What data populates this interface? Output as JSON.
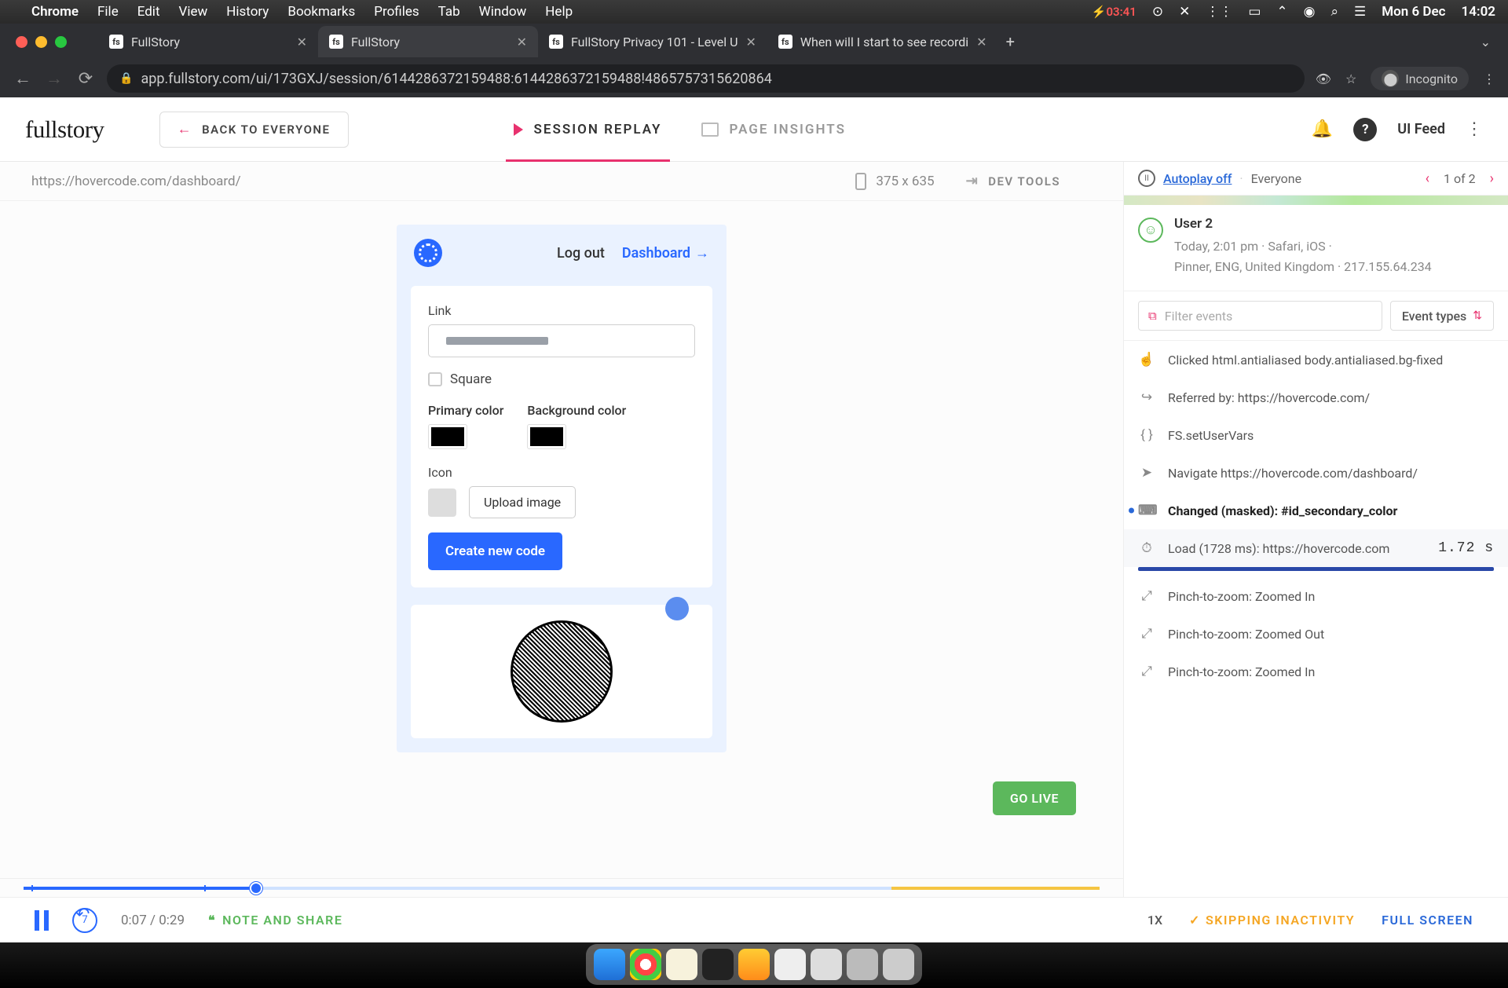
{
  "menubar": {
    "app": "Chrome",
    "items": [
      "File",
      "Edit",
      "View",
      "History",
      "Bookmarks",
      "Profiles",
      "Tab",
      "Window",
      "Help"
    ],
    "battery_time": "03:41",
    "date": "Mon 6 Dec",
    "clock": "14:02"
  },
  "browser": {
    "tabs": [
      {
        "title": "FullStory",
        "active": false
      },
      {
        "title": "FullStory",
        "active": true
      },
      {
        "title": "FullStory Privacy 101 - Level U",
        "active": false
      },
      {
        "title": "When will I start to see recordi",
        "active": false
      }
    ],
    "url": "app.fullstory.com/ui/173GXJ/session/6144286372159488:6144286372159488!4865757315620864",
    "incognito": "Incognito"
  },
  "header": {
    "logo": "fullstory",
    "back": "BACK TO EVERYONE",
    "tab_replay": "SESSION REPLAY",
    "tab_insights": "PAGE INSIGHTS",
    "ui_feed": "UI Feed"
  },
  "subbar": {
    "url": "https://hovercode.com/dashboard/",
    "dims": "375 x 635",
    "dev_tools": "DEV TOOLS"
  },
  "replay": {
    "logout": "Log out",
    "dashboard": "Dashboard",
    "link_label": "Link",
    "square_label": "Square",
    "primary_label": "Primary color",
    "background_label": "Background color",
    "icon_label": "Icon",
    "upload_label": "Upload image",
    "create_label": "Create new code",
    "go_live": "GO LIVE"
  },
  "event_pane": {
    "autoplay": "Autoplay off",
    "segment": "Everyone",
    "pager": "1 of 2",
    "user": {
      "name": "User 2",
      "line1": "Today, 2:01 pm  ·  Safari, iOS  ·",
      "line2": "Pinner, ENG, United Kingdom  ·  217.155.64.234"
    },
    "filter_placeholder": "Filter events",
    "event_types": "Event types",
    "events": [
      {
        "icon": "click",
        "text": "Clicked html.antialiased body.antialiased.bg-fixed"
      },
      {
        "icon": "referrer",
        "text": "Referred by: https://hovercode.com/"
      },
      {
        "icon": "code",
        "text": "FS.setUserVars"
      },
      {
        "icon": "navigate",
        "text": "Navigate https://hovercode.com/dashboard/"
      },
      {
        "icon": "keyboard",
        "text": "Changed (masked): #id_secondary_color",
        "current": true
      },
      {
        "icon": "load",
        "text": "Load (1728 ms): https://hovercode.com",
        "time": "1.72 s",
        "load": true
      },
      {
        "icon": "zoom",
        "text": "Pinch-to-zoom: Zoomed In"
      },
      {
        "icon": "zoom",
        "text": "Pinch-to-zoom: Zoomed Out"
      },
      {
        "icon": "zoom",
        "text": "Pinch-to-zoom: Zoomed In"
      }
    ]
  },
  "playback": {
    "time": "0:07 / 0:29",
    "note_share": "NOTE AND SHARE",
    "speed": "1X",
    "skip": "SKIPPING INACTIVITY",
    "fullscreen": "FULL SCREEN",
    "rewind": "7"
  }
}
